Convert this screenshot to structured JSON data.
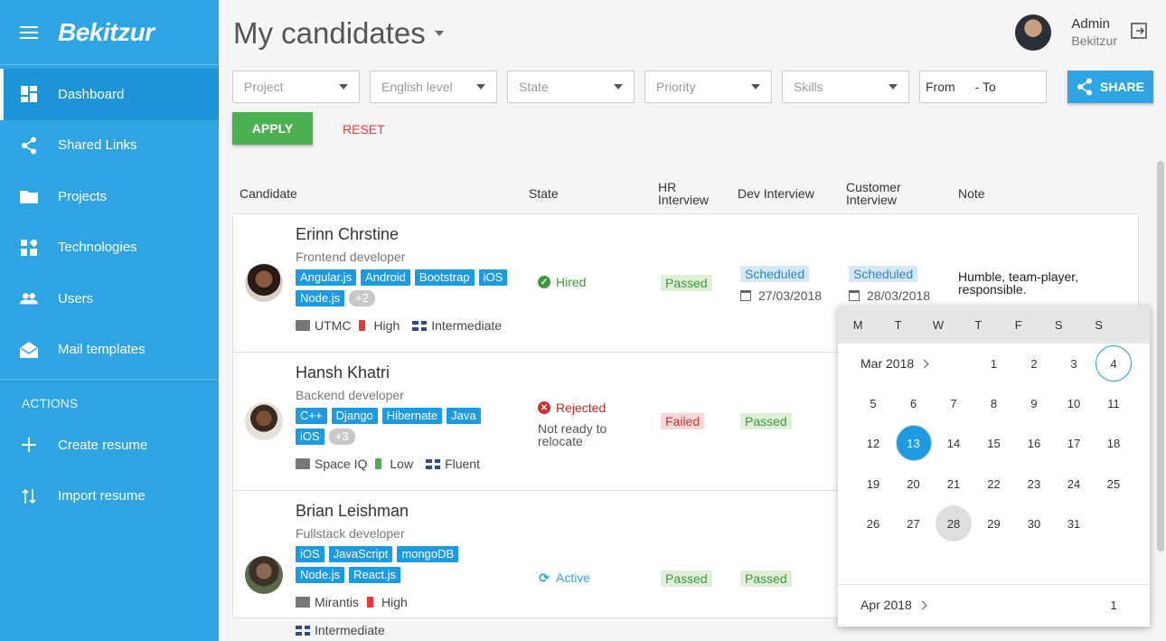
{
  "app": {
    "logo": "Bekitzur"
  },
  "sidebar": {
    "items": [
      {
        "label": "Dashboard",
        "icon": "dashboard-icon"
      },
      {
        "label": "Shared Links",
        "icon": "share-icon"
      },
      {
        "label": "Projects",
        "icon": "folder-icon"
      },
      {
        "label": "Technologies",
        "icon": "widgets-icon"
      },
      {
        "label": "Users",
        "icon": "users-icon"
      },
      {
        "label": "Mail templates",
        "icon": "mail-icon"
      }
    ],
    "actions_label": "ACTIONS",
    "actions": [
      {
        "label": "Create resume",
        "icon": "plus-icon"
      },
      {
        "label": "Import resume",
        "icon": "import-icon"
      }
    ]
  },
  "header": {
    "title": "My candidates",
    "user_name": "Admin",
    "user_org": "Bekitzur"
  },
  "filters": {
    "project": "Project",
    "english": "English level",
    "state": "State",
    "priority": "Priority",
    "skills": "Skills",
    "from": "From",
    "to": "- To",
    "share": "SHARE",
    "apply": "APPLY",
    "reset": "RESET"
  },
  "table": {
    "headers": {
      "candidate": "Candidate",
      "state": "State",
      "hr1": "HR",
      "hr2": "Interview",
      "dev": "Dev Interview",
      "cust1": "Customer",
      "cust2": "Interview",
      "note": "Note"
    },
    "rows": [
      {
        "name": "Erinn Chrstine",
        "role": "Frontend developer",
        "tags": [
          "Angular.js",
          "Android",
          "Bootstrap",
          "iOS",
          "Node.js"
        ],
        "more": "+2",
        "project": "UTMC",
        "priority": "High",
        "english": "Intermediate",
        "state": "Hired",
        "hr": "Passed",
        "dev": "Scheduled",
        "dev_date": "27/03/2018",
        "cust": "Scheduled",
        "cust_date": "28/03/2018",
        "note": "Humble, team-player, responsible."
      },
      {
        "name": "Hansh Khatri",
        "role": "Backend developer",
        "tags": [
          "C++",
          "Django",
          "Hibernate",
          "Java",
          "iOS"
        ],
        "more": "+3",
        "project": "Space IQ",
        "priority": "Low",
        "english": "Fluent",
        "state": "Rejected",
        "state_note": "Not ready to relocate",
        "hr": "Failed",
        "dev": "Passed"
      },
      {
        "name": "Brian Leishman",
        "role": "Fullstack developer",
        "tags": [
          "iOS",
          "JavaScript",
          "mongoDB",
          "Node.js",
          "React.js"
        ],
        "project": "Mirantis",
        "priority": "High",
        "english": "Intermediate",
        "state": "Active",
        "hr": "Passed",
        "dev": "Passed"
      }
    ]
  },
  "datepicker": {
    "weekdays": [
      "M",
      "T",
      "W",
      "T",
      "F",
      "S",
      "S"
    ],
    "month1": "Mar 2018",
    "month2": "Apr 2018",
    "days": [
      "1",
      "2",
      "3",
      "4",
      "5",
      "6",
      "7",
      "8",
      "9",
      "10",
      "11",
      "12",
      "13",
      "14",
      "15",
      "16",
      "17",
      "18",
      "19",
      "20",
      "21",
      "22",
      "23",
      "24",
      "25",
      "26",
      "27",
      "28",
      "29",
      "30",
      "31"
    ],
    "next_first": "1",
    "today": "4",
    "selected": "13",
    "highlight": "28"
  },
  "colors": {
    "sidebar": "#2fa4e3",
    "accent": "#1e9be0",
    "apply": "#4caf50",
    "reset": "#e53935"
  }
}
